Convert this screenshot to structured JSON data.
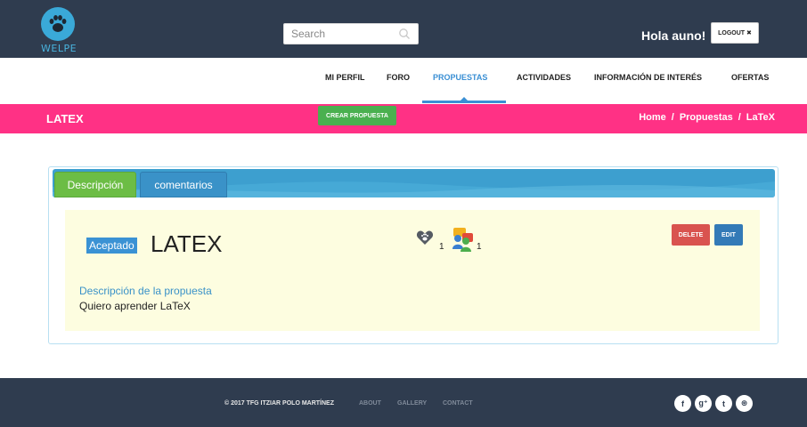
{
  "header": {
    "logo_text": "WELPE",
    "search_placeholder": "Search",
    "greeting": "Hola auno!",
    "logout_label": "LOGOUT ✖"
  },
  "nav": {
    "items": [
      {
        "label": "MI PERFIL"
      },
      {
        "label": "FORO"
      },
      {
        "label": "PROPUESTAS"
      },
      {
        "label": "ACTIVIDADES"
      },
      {
        "label": "INFORMACIÓN DE INTERÉS"
      },
      {
        "label": "OFERTAS"
      }
    ],
    "active": "PROPUESTAS"
  },
  "band": {
    "title": "LATEX",
    "create_label": "CREAR PROPUESTA",
    "breadcrumb": [
      "Home",
      "Propuestas",
      "LaTeX"
    ],
    "separator": "/"
  },
  "tabs": [
    {
      "label": "Descripción"
    },
    {
      "label": "comentarios"
    }
  ],
  "proposal": {
    "status": "Aceptado",
    "title": "LATEX",
    "likes": "1",
    "participants": "1",
    "delete_label": "DELETE",
    "edit_label": "EDIT",
    "desc_heading": "Descripción de la propuesta",
    "desc_text": "Quiero aprender LaTeX"
  },
  "footer": {
    "copyright": "© 2017 TFG ITZIAR POLO MARTÍNEZ",
    "links": [
      {
        "label": "ABOUT"
      },
      {
        "label": "GALLERY"
      },
      {
        "label": "CONTACT"
      }
    ],
    "social": [
      {
        "glyph": "f",
        "name": "facebook-icon"
      },
      {
        "glyph": "g⁺",
        "name": "google-plus-icon"
      },
      {
        "glyph": "t",
        "name": "twitter-icon"
      },
      {
        "glyph": "⊛",
        "name": "dribbble-icon"
      }
    ]
  },
  "colors": {
    "topbar": "#2f3c4f",
    "accent_pink": "#ff3185",
    "nav_active": "#3a8fd4",
    "create_green": "#4ab04f",
    "delete_red": "#d9534f",
    "edit_blue": "#337ab7",
    "card_bg": "#fdfde0"
  }
}
